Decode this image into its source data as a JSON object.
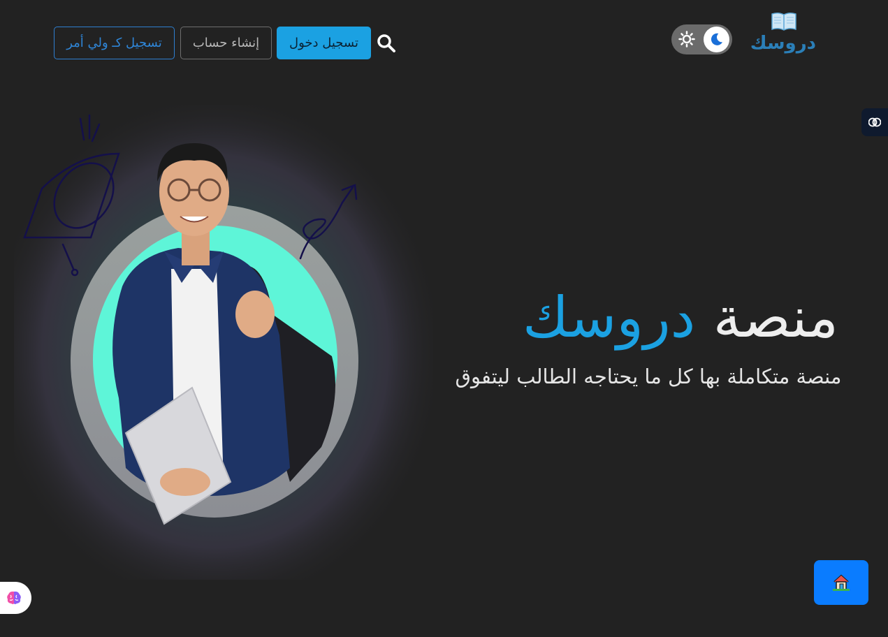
{
  "header": {
    "logo_text": "دروسك",
    "logo_icon": "open-book-icon",
    "theme_toggle": {
      "light_icon": "sun-icon",
      "dark_icon": "moon-icon",
      "active": "dark"
    },
    "search_icon": "search-icon",
    "buttons": {
      "login": "تسجيل دخول",
      "register": "إنشاء حساب",
      "parent": "تسجيل كـ ولي أمر"
    }
  },
  "hero": {
    "title_part1": "منصة",
    "title_part2": "دروسك",
    "subtitle": "منصة متكاملة بها كل ما يحتاجه الطالب ليتفوق"
  },
  "widgets": {
    "side_tab_icon": "brain-icon",
    "floating_brain_icon": "brain-icon",
    "home_button_icon": "house-icon"
  },
  "colors": {
    "background": "#222222",
    "accent": "#1ba1e2",
    "parent_button": "#2f86d8",
    "home_fab": "#0a7cff",
    "hero_circle": "#5ef5d8"
  }
}
